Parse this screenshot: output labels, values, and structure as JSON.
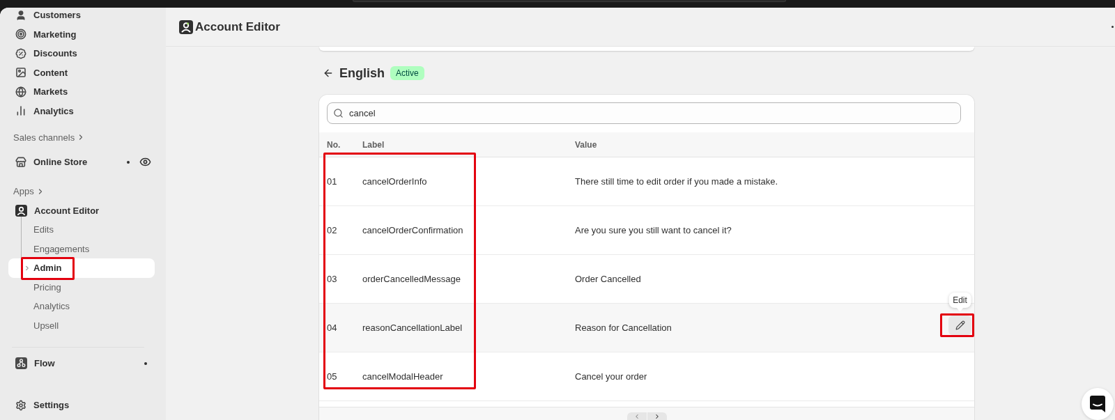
{
  "sidebar": {
    "items": [
      {
        "label": "Customers"
      },
      {
        "label": "Marketing"
      },
      {
        "label": "Discounts"
      },
      {
        "label": "Content"
      },
      {
        "label": "Markets"
      },
      {
        "label": "Analytics"
      }
    ],
    "sales_channels": {
      "heading": "Sales channels",
      "items": [
        {
          "label": "Online Store",
          "badge_dot": true
        }
      ]
    },
    "apps": {
      "heading": "Apps",
      "items": [
        {
          "label": "Account Editor",
          "children": [
            {
              "label": "Edits",
              "selected": false
            },
            {
              "label": "Engagements",
              "selected": false
            },
            {
              "label": "Admin",
              "selected": true
            },
            {
              "label": "Pricing",
              "selected": false
            },
            {
              "label": "Analytics",
              "selected": false
            },
            {
              "label": "Upsell",
              "selected": false
            }
          ]
        },
        {
          "label": "Flow",
          "badge_dot": true
        }
      ]
    },
    "settings": {
      "label": "Settings"
    }
  },
  "header": {
    "title": "Account Editor"
  },
  "page": {
    "title": "English",
    "status": "Active",
    "search": {
      "value": "cancel"
    },
    "table": {
      "columns": [
        "No.",
        "Label",
        "Value"
      ],
      "edit_tooltip": "Edit",
      "rows": [
        {
          "no": "01",
          "label": "cancelOrderInfo",
          "value": "There still time to edit order if you made a mistake.",
          "hovered": false
        },
        {
          "no": "02",
          "label": "cancelOrderConfirmation",
          "value": "Are you sure you still want to cancel it?",
          "hovered": false
        },
        {
          "no": "03",
          "label": "orderCancelledMessage",
          "value": "Order Cancelled",
          "hovered": false
        },
        {
          "no": "04",
          "label": "reasonCancellationLabel",
          "value": "Reason for Cancellation",
          "hovered": true
        },
        {
          "no": "05",
          "label": "cancelModalHeader",
          "value": "Cancel your order",
          "hovered": false
        }
      ]
    }
  },
  "annotations": {
    "sidebar_item": true,
    "table_rows": true,
    "edit_button": true
  }
}
